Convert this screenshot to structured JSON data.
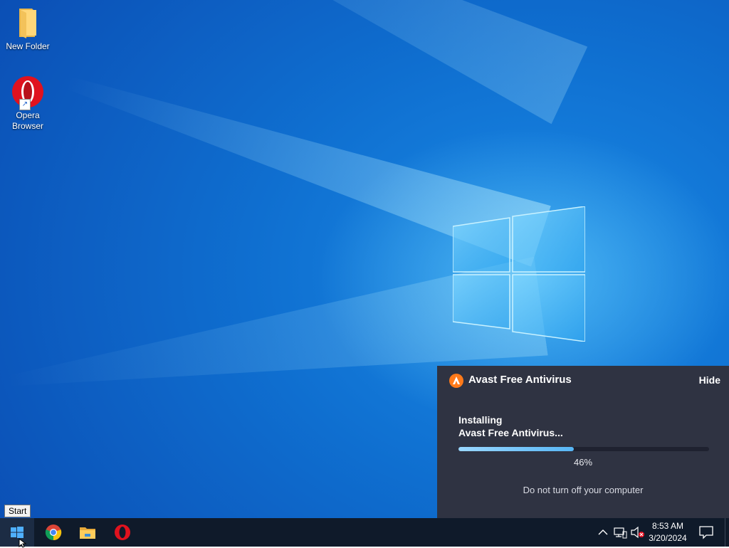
{
  "desktop": {
    "icons": [
      {
        "label": "New Folder",
        "icon": "folder-icon"
      },
      {
        "label": "Opera Browser",
        "icon": "opera-icon",
        "shortcut": true
      }
    ]
  },
  "avast_panel": {
    "title": "Avast Free Antivirus",
    "hide_label": "Hide",
    "status_line1": "Installing",
    "status_line2": "Avast Free Antivirus...",
    "progress": 0.46,
    "progress_text": "46%",
    "warning": "Do not turn off your computer",
    "accent_color": "#ff7a1a",
    "bar_color": "#57b6f5"
  },
  "tooltip": {
    "text": "Start"
  },
  "taskbar": {
    "pinned": [
      {
        "name": "start",
        "icon": "windows-logo-icon"
      },
      {
        "name": "chrome",
        "icon": "chrome-icon"
      },
      {
        "name": "file-explorer",
        "icon": "folder-icon"
      },
      {
        "name": "opera",
        "icon": "opera-icon"
      }
    ],
    "tray": {
      "icons": [
        "chevron-up-icon",
        "network-icon",
        "volume-muted-icon",
        "notification-icon"
      ],
      "time": "8:53 AM",
      "date": "3/20/2024"
    }
  }
}
